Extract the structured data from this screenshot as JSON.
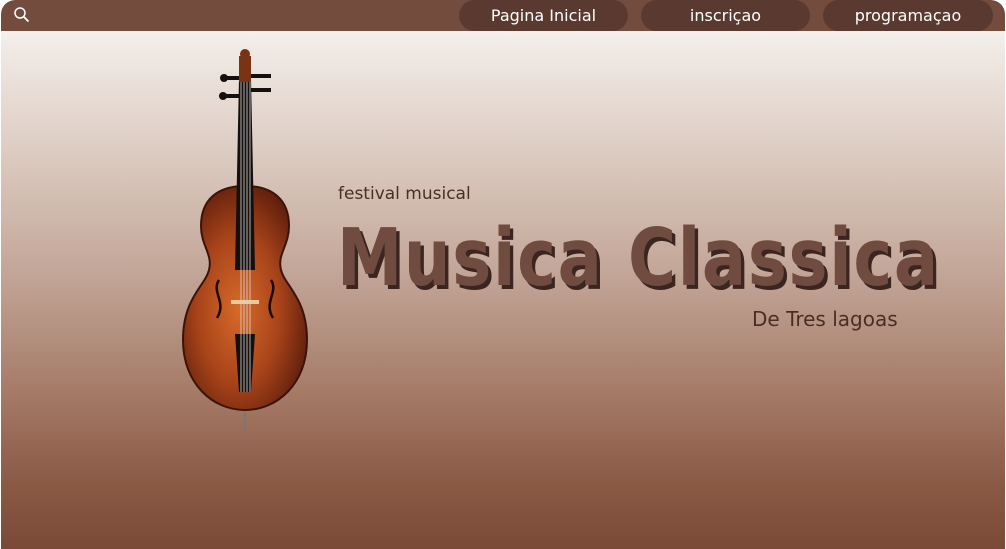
{
  "nav": {
    "items": [
      {
        "label": "Pagina Inicial"
      },
      {
        "label": "inscriçao"
      },
      {
        "label": "programaçao"
      }
    ]
  },
  "hero": {
    "subtitle": "festival musical",
    "title": "Musica Classica",
    "place": "De Tres lagoas"
  },
  "colors": {
    "topbar": "#744c3e",
    "nav_button": "#5a3a30",
    "title": "#6f4b40"
  },
  "icons": [
    "search-icon",
    "cello-image"
  ]
}
